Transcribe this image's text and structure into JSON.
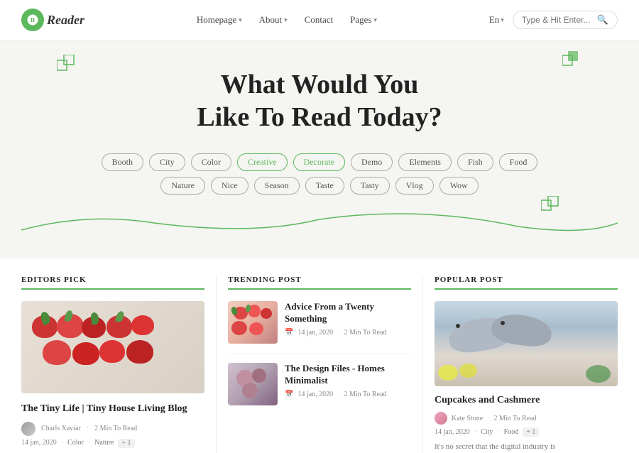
{
  "nav": {
    "logo_text": "Reader",
    "links": [
      {
        "label": "Homepage",
        "has_dropdown": true
      },
      {
        "label": "About",
        "has_dropdown": true
      },
      {
        "label": "Contact",
        "has_dropdown": false
      },
      {
        "label": "Pages",
        "has_dropdown": true
      }
    ],
    "lang": "En",
    "search_placeholder": "Type & Hit Enter..."
  },
  "hero": {
    "title_line1": "What Would You",
    "title_line2": "Like To Read Today?"
  },
  "tags_row1": [
    {
      "label": "Booth"
    },
    {
      "label": "City"
    },
    {
      "label": "Color"
    },
    {
      "label": "Creative",
      "active": true
    },
    {
      "label": "Decorate",
      "active": true
    },
    {
      "label": "Demo"
    },
    {
      "label": "Elements"
    },
    {
      "label": "Fish"
    },
    {
      "label": "Food"
    }
  ],
  "tags_row2": [
    {
      "label": "Nature"
    },
    {
      "label": "Nice"
    },
    {
      "label": "Season"
    },
    {
      "label": "Taste"
    },
    {
      "label": "Tasty"
    },
    {
      "label": "Vlog"
    },
    {
      "label": "Wow"
    }
  ],
  "editors_pick": {
    "section_title": "EDITORS PICK",
    "post_title": "The Tiny Life | Tiny House Living Blog",
    "author": "Charls Xaviar",
    "read_time": "2 Min To Read",
    "date": "14 jan, 2020",
    "tags": [
      "Color",
      "Nature"
    ],
    "tag_extra": "+ 1"
  },
  "trending_post": {
    "section_title": "TRENDING POST",
    "items": [
      {
        "title": "Advice From a Twenty Something",
        "date": "14 jan, 2020",
        "read_time": "2 Min To Read"
      },
      {
        "title": "The Design Files - Homes Minimalist",
        "date": "14 jan, 2020",
        "read_time": "2 Min To Read"
      }
    ]
  },
  "popular_post": {
    "section_title": "POPULAR POST",
    "post_title": "Cupcakes and Cashmere",
    "author": "Kate Stone",
    "read_time": "2 Min To Read",
    "date": "14 jan, 2020",
    "tags": [
      "City",
      "Food"
    ],
    "tag_extra": "+ 1",
    "description": "It's no secret that the digital industry is"
  }
}
